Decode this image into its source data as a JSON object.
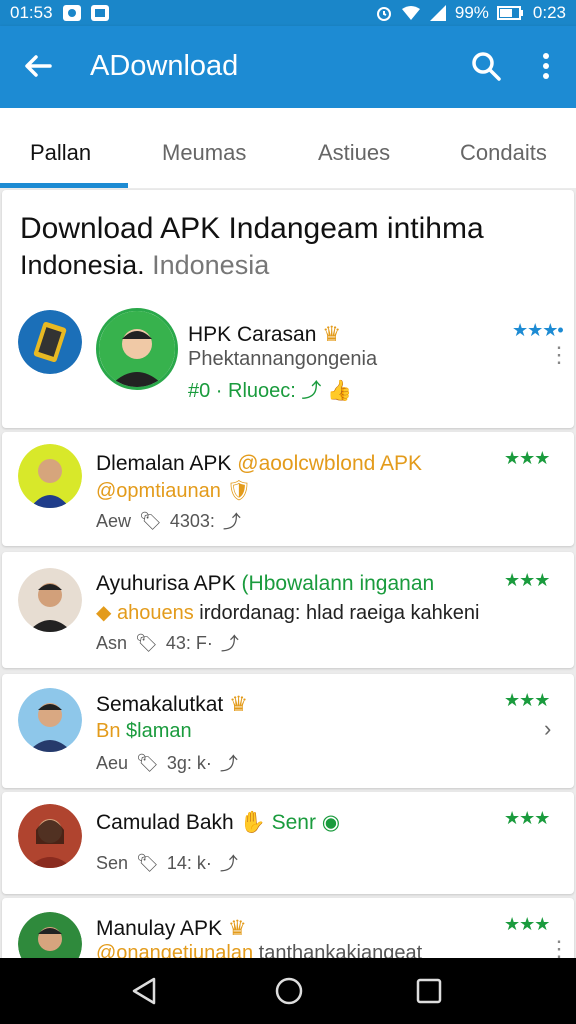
{
  "status_bar": {
    "time_left": "01:53",
    "battery": "99%",
    "clock": "0:23"
  },
  "app_bar": {
    "title": "ADownload"
  },
  "tabs": [
    "Pallan",
    "Meumas",
    "Astiues",
    "Condaits"
  ],
  "featured": {
    "heading": "Download APK Indangeam intihma",
    "sub_main": "Indonesia.",
    "sub_grey": " Indonesia",
    "app": {
      "name": "HPK Carasan",
      "desc": "Phektannangongenia",
      "meta": "#0 · Rluoec:"
    }
  },
  "list": [
    {
      "name": "Dlemalan APK",
      "name_extra": "@aoolcwblond APK",
      "sub": "@opmtiaunan",
      "meta": "Aew",
      "meta2": "4303:"
    },
    {
      "name": "Ayuhurisa APK",
      "name_extra": "(Hbowalann inganan",
      "sub_orange": "ahouens",
      "sub_rest": " irdordanag: hlad raeiga kahkeni",
      "meta": "Asn",
      "meta2": "43: F·"
    },
    {
      "name": "Semakalutkat",
      "sub_left": "Bn",
      "sub_right": "$laman",
      "meta": "Aeu",
      "meta2": "3g: k·"
    },
    {
      "name": "Camulad Bakh",
      "name_extra": "Senr",
      "meta": "Sen",
      "meta2": "14: k·"
    },
    {
      "name": "Manulay APK",
      "sub_orange": "@onangetiunalan",
      "sub_rest": " tanthankakiangeat"
    }
  ],
  "colors": {
    "app_bar": "#1d8bd3",
    "status_bar": "#1a86c9",
    "accent_green": "#1a9b3d",
    "accent_orange": "#e39b1b"
  }
}
